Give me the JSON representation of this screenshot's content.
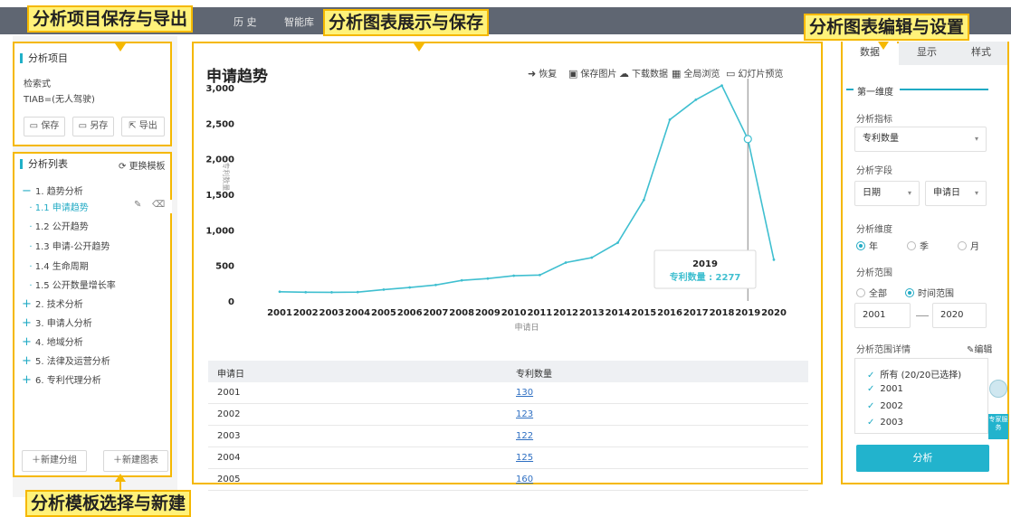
{
  "nav": {
    "history": "历 史",
    "smart_lib": "智能库"
  },
  "callouts": {
    "top_left": "分析项目保存与导出",
    "top_center": "分析图表展示与保存",
    "top_right": "分析图表编辑与设置",
    "bottom_left": "分析模板选择与新建"
  },
  "project": {
    "title": "分析项目",
    "query_label": "检索式",
    "query": "TIAB=(无人驾驶)",
    "save": "保存",
    "save_as": "另存",
    "export": "导出"
  },
  "analysis_list": {
    "title": "分析列表",
    "switch_template": "更换模板",
    "items": [
      {
        "label": "1.  趋势分析",
        "level": 0,
        "expanded": true
      },
      {
        "label": "1.1 申请趋势",
        "level": 1,
        "active": true
      },
      {
        "label": "1.2 公开趋势",
        "level": 1
      },
      {
        "label": "1.3 申请-公开趋势",
        "level": 1
      },
      {
        "label": "1.4 生命周期",
        "level": 1
      },
      {
        "label": "1.5 公开数量增长率",
        "level": 1
      },
      {
        "label": "2.  技术分析",
        "level": 0
      },
      {
        "label": "3.  申请人分析",
        "level": 0
      },
      {
        "label": "4.  地域分析",
        "level": 0
      },
      {
        "label": "5.  法律及运营分析",
        "level": 0
      },
      {
        "label": "6.  专利代理分析",
        "level": 0
      }
    ],
    "new_group": "新建分组",
    "new_chart": "新建图表"
  },
  "chart_panel": {
    "title": "申请趋势",
    "tools": [
      "恢复",
      "保存图片",
      "下载数据",
      "全局浏览",
      "幻灯片预览"
    ],
    "tooltip": {
      "year": "2019",
      "text": "专利数量 : 2277"
    }
  },
  "chart_data": {
    "type": "line",
    "title": "申请趋势",
    "xlabel": "申请日",
    "ylabel": "专利数量",
    "x": [
      "2001",
      "2002",
      "2003",
      "2004",
      "2005",
      "2006",
      "2007",
      "2008",
      "2009",
      "2010",
      "2011",
      "2012",
      "2013",
      "2014",
      "2015",
      "2016",
      "2017",
      "2018",
      "2019",
      "2020"
    ],
    "series": [
      {
        "values": [
          130,
          123,
          122,
          125,
          160,
          190,
          225,
          290,
          315,
          355,
          365,
          540,
          610,
          820,
          1420,
          2550,
          2830,
          3030,
          2277,
          580
        ]
      }
    ],
    "ylim": [
      0,
      3000
    ],
    "yticks": [
      "0",
      "500",
      "1,000",
      "1,500",
      "2,000",
      "2,500",
      "3,000"
    ],
    "highlight_index": 18,
    "color": "#3fbfd0"
  },
  "table": {
    "headers": [
      "申请日",
      "专利数量"
    ],
    "rows": [
      [
        "2001",
        "130"
      ],
      [
        "2002",
        "123"
      ],
      [
        "2003",
        "122"
      ],
      [
        "2004",
        "125"
      ],
      [
        "2005",
        "160"
      ]
    ]
  },
  "settings": {
    "tabs": [
      "数据",
      "显示",
      "样式"
    ],
    "dimension_header": "第一维度",
    "metric_label": "分析指标",
    "metric_value": "专利数量",
    "field_label": "分析字段",
    "field_type": "日期",
    "field_value": "申请日",
    "granularity_label": "分析维度",
    "granularity": [
      "年",
      "季",
      "月"
    ],
    "range_label": "分析范围",
    "range_options": [
      "全部",
      "时间范围"
    ],
    "range_from": "2001",
    "range_to": "2020",
    "range_detail_label": "分析范围详情",
    "edit": "编辑",
    "checks": [
      "所有  (20/20已选择)",
      "2001",
      "2002",
      "2003"
    ],
    "expert_service": "专家服务",
    "analyze": "分析"
  }
}
